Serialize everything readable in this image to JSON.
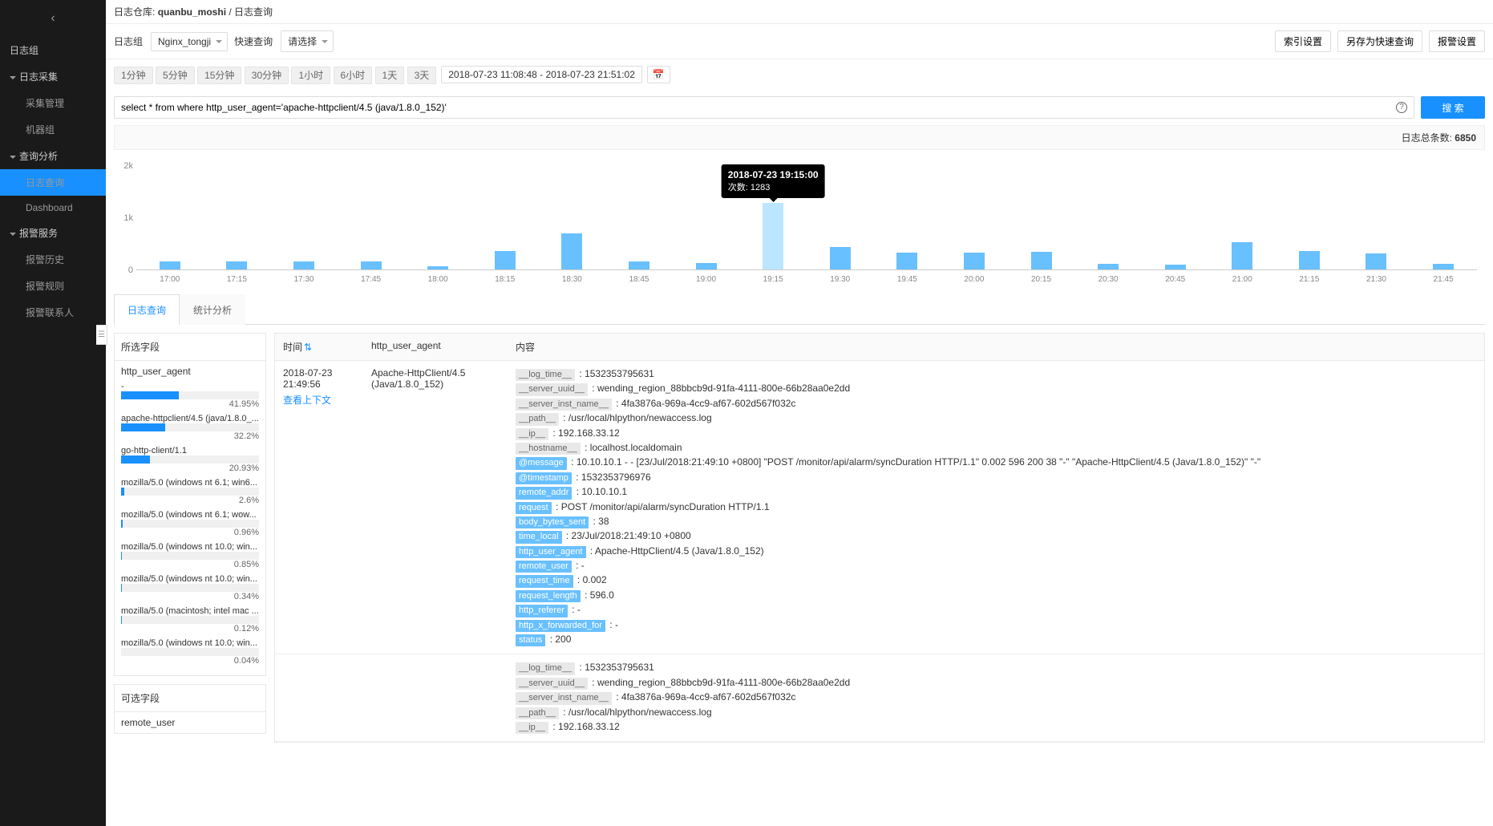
{
  "breadcrumb": {
    "prefix": "日志仓库:",
    "repo": "quanbu_moshi",
    "page": "日志查询"
  },
  "sidebar": {
    "items": [
      {
        "label": "日志组",
        "kind": "group",
        "caret": false
      },
      {
        "label": "日志采集",
        "kind": "group",
        "caret": true
      },
      {
        "label": "采集管理",
        "kind": "sub"
      },
      {
        "label": "机器组",
        "kind": "sub"
      },
      {
        "label": "查询分析",
        "kind": "group",
        "caret": true
      },
      {
        "label": "日志查询",
        "kind": "sub",
        "selected": true
      },
      {
        "label": "Dashboard",
        "kind": "sub"
      },
      {
        "label": "报警服务",
        "kind": "group",
        "caret": true
      },
      {
        "label": "报警历史",
        "kind": "sub"
      },
      {
        "label": "报警规则",
        "kind": "sub"
      },
      {
        "label": "报警联系人",
        "kind": "sub"
      }
    ]
  },
  "toolbar": {
    "group_label": "日志组",
    "group_value": "Nginx_tongji",
    "quick_label": "快速查询",
    "quick_value": "请选择",
    "index_btn": "索引设置",
    "saveas_btn": "另存为快速查询",
    "alarm_btn": "报警设置"
  },
  "timebar": {
    "presets": [
      "1分钟",
      "5分钟",
      "15分钟",
      "30分钟",
      "1小时",
      "6小时",
      "1天",
      "3天"
    ],
    "range": "2018-07-23 11:08:48 - 2018-07-23 21:51:02"
  },
  "search": {
    "value": "select * from where http_user_agent='apache-httpclient/4.5 (java/1.8.0_152)'",
    "btn": "搜 索"
  },
  "total": {
    "label": "日志总条数:",
    "value": "6850"
  },
  "chart_data": {
    "type": "bar",
    "categories": [
      "17:00",
      "17:15",
      "17:30",
      "17:45",
      "18:00",
      "18:15",
      "18:30",
      "18:45",
      "19:00",
      "19:15",
      "19:30",
      "19:45",
      "20:00",
      "20:15",
      "20:30",
      "20:45",
      "21:00",
      "21:15",
      "21:30",
      "21:45"
    ],
    "values": [
      160,
      150,
      155,
      150,
      70,
      350,
      700,
      160,
      120,
      1283,
      440,
      320,
      320,
      340,
      110,
      100,
      530,
      350,
      310,
      110
    ],
    "yticks": [
      0,
      1000,
      2000
    ],
    "yticklabels": [
      "0",
      "1k",
      "2k"
    ],
    "xlabel": "",
    "ylabel": "",
    "ylim": [
      0,
      2000
    ],
    "highlight_index": 9,
    "tooltip": {
      "title": "2018-07-23 19:15:00",
      "context": "次数: 1283"
    }
  },
  "tabs": {
    "log": "日志查询",
    "stat": "统计分析"
  },
  "fields": {
    "selected_h": "所选字段",
    "selected_name": "http_user_agent",
    "stats": [
      {
        "label": "-",
        "pct": 41.95
      },
      {
        "label": "apache-httpclient/4.5 (java/1.8.0_...",
        "pct": 32.2
      },
      {
        "label": "go-http-client/1.1",
        "pct": 20.93
      },
      {
        "label": "mozilla/5.0 (windows nt 6.1; win6...",
        "pct": 2.6
      },
      {
        "label": "mozilla/5.0 (windows nt 6.1; wow...",
        "pct": 0.96
      },
      {
        "label": "mozilla/5.0 (windows nt 10.0; win...",
        "pct": 0.85
      },
      {
        "label": "mozilla/5.0 (windows nt 10.0; win...",
        "pct": 0.34
      },
      {
        "label": "mozilla/5.0 (macintosh; intel mac ...",
        "pct": 0.12
      },
      {
        "label": "mozilla/5.0 (windows nt 10.0; win...",
        "pct": 0.04
      }
    ],
    "optional_h": "可选字段",
    "optional_items": [
      "remote_user"
    ]
  },
  "table": {
    "th_time": "时间",
    "th_ua": "http_user_agent",
    "th_content": "内容",
    "ctx_link": "查看上下文",
    "rows": [
      {
        "time": "2018-07-23 21:49:56",
        "ua": "Apache-HttpClient/4.5 (Java/1.8.0_152)",
        "content": [
          {
            "tag": "__log_time__",
            "hl": false,
            "val": "1532353795631"
          },
          {
            "tag": "__server_uuid__",
            "hl": false,
            "val": "wending_region_88bbcb9d-91fa-4111-800e-66b28aa0e2dd"
          },
          {
            "tag": "__server_inst_name__",
            "hl": false,
            "val": "4fa3876a-969a-4cc9-af67-602d567f032c"
          },
          {
            "tag": "__path__",
            "hl": false,
            "val": "/usr/local/hlpython/newaccess.log"
          },
          {
            "tag": "__ip__",
            "hl": false,
            "val": "192.168.33.12"
          },
          {
            "tag": "__hostname__",
            "hl": false,
            "val": "localhost.localdomain"
          },
          {
            "tag": "@message",
            "hl": true,
            "val": "10.10.10.1 - - [23/Jul/2018:21:49:10 +0800] \"POST /monitor/api/alarm/syncDuration HTTP/1.1\" 0.002 596 200 38 \"-\" \"Apache-HttpClient/4.5 (Java/1.8.0_152)\" \"-\""
          },
          {
            "tag": "@timestamp",
            "hl": true,
            "val": "1532353796976"
          },
          {
            "tag": "remote_addr",
            "hl": true,
            "val": "10.10.10.1"
          },
          {
            "tag": "request",
            "hl": true,
            "val": "POST /monitor/api/alarm/syncDuration HTTP/1.1"
          },
          {
            "tag": "body_bytes_sent",
            "hl": true,
            "val": "38"
          },
          {
            "tag": "time_local",
            "hl": true,
            "val": "23/Jul/2018:21:49:10 +0800"
          },
          {
            "tag": "http_user_agent",
            "hl": true,
            "val": "Apache-HttpClient/4.5 (Java/1.8.0_152)"
          },
          {
            "tag": "remote_user",
            "hl": true,
            "val": "-"
          },
          {
            "tag": "request_time",
            "hl": true,
            "val": "0.002"
          },
          {
            "tag": "request_length",
            "hl": true,
            "val": "596.0"
          },
          {
            "tag": "http_referer",
            "hl": true,
            "val": "-"
          },
          {
            "tag": "http_x_forwarded_for",
            "hl": true,
            "val": "-"
          },
          {
            "tag": "status",
            "hl": true,
            "val": "200"
          }
        ]
      },
      {
        "time": "",
        "ua": "",
        "content": [
          {
            "tag": "__log_time__",
            "hl": false,
            "val": "1532353795631"
          },
          {
            "tag": "__server_uuid__",
            "hl": false,
            "val": "wending_region_88bbcb9d-91fa-4111-800e-66b28aa0e2dd"
          },
          {
            "tag": "__server_inst_name__",
            "hl": false,
            "val": "4fa3876a-969a-4cc9-af67-602d567f032c"
          },
          {
            "tag": "__path__",
            "hl": false,
            "val": "/usr/local/hlpython/newaccess.log"
          },
          {
            "tag": "__ip__",
            "hl": false,
            "val": "192.168.33.12"
          }
        ]
      }
    ]
  }
}
